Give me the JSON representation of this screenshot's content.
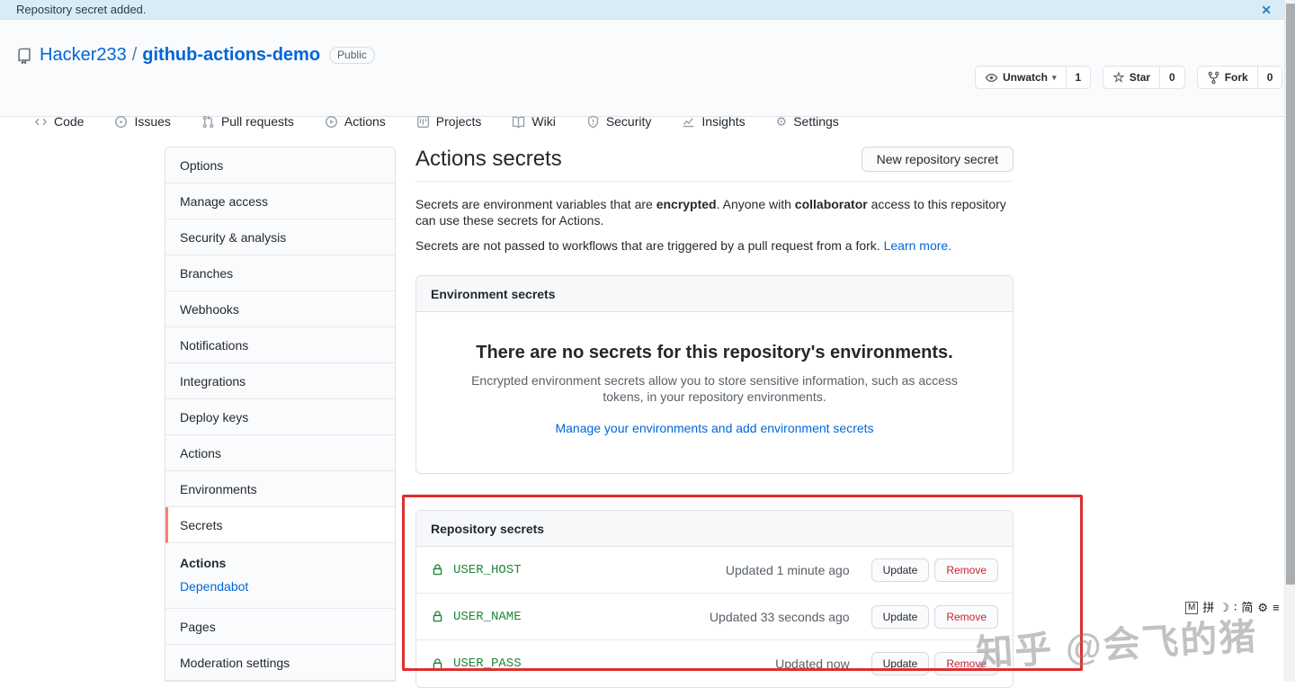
{
  "colors": {
    "link_blue": "#0366d6",
    "secret_green": "#22863a",
    "selected_menu_accent": "#f9826c",
    "danger_red": "#cb2431",
    "annotation_red": "#e12d2d",
    "banner_bg": "#d8ecf7"
  },
  "icons": {
    "close": "✕",
    "caret_down": "▾",
    "star": "☆",
    "gear": "⚙"
  },
  "banner": {
    "message": "Repository secret added."
  },
  "repo_header": {
    "owner": "Hacker233",
    "separator": "/",
    "name": "github-actions-demo",
    "visibility_badge": "Public",
    "social": {
      "watch": {
        "label": "Unwatch",
        "count": "1"
      },
      "star": {
        "label": "Star",
        "count": "0"
      },
      "fork": {
        "label": "Fork",
        "count": "0"
      }
    }
  },
  "nav": {
    "tabs": [
      {
        "label": "Code"
      },
      {
        "label": "Issues"
      },
      {
        "label": "Pull requests"
      },
      {
        "label": "Actions"
      },
      {
        "label": "Projects"
      },
      {
        "label": "Wiki"
      },
      {
        "label": "Security"
      },
      {
        "label": "Insights"
      },
      {
        "label": "Settings"
      }
    ]
  },
  "sidebar": {
    "items": [
      "Options",
      "Manage access",
      "Security & analysis",
      "Branches",
      "Webhooks",
      "Notifications",
      "Integrations",
      "Deploy keys",
      "Actions",
      "Environments",
      "Secrets"
    ],
    "selected_item": "Secrets",
    "secrets_subnav": {
      "section_label": "Actions",
      "link_label": "Dependabot"
    },
    "bottom_items": [
      "Pages",
      "Moderation settings"
    ]
  },
  "main": {
    "title": "Actions secrets",
    "new_secret_button": "New repository secret",
    "intro": {
      "p1a": "Secrets are environment variables that are ",
      "p1_bold1": "encrypted",
      "p1b": ". Anyone with ",
      "p1_bold2": "collaborator",
      "p1c": " access to this repository can use these secrets for Actions.",
      "p2": "Secrets are not passed to workflows that are triggered by a pull request from a fork. ",
      "p2_link": "Learn more."
    },
    "environment_secrets": {
      "header": "Environment secrets",
      "empty_title": "There are no secrets for this repository's environments.",
      "empty_description": "Encrypted environment secrets allow you to store sensitive information, such as access tokens, in your repository environments.",
      "empty_link": "Manage your environments and add environment secrets"
    },
    "repository_secrets": {
      "header": "Repository secrets",
      "update_label": "Update",
      "remove_label": "Remove",
      "rows": [
        {
          "name": "USER_HOST",
          "updated": "Updated 1 minute ago"
        },
        {
          "name": "USER_NAME",
          "updated": "Updated 33 seconds ago"
        },
        {
          "name": "USER_PASS",
          "updated": "Updated now"
        }
      ]
    }
  },
  "watermark": "知乎 @会飞的猪",
  "ime_bar": {
    "icons": [
      "M",
      "拼",
      "☽",
      "∶",
      "简",
      "⚙",
      "≡"
    ]
  }
}
